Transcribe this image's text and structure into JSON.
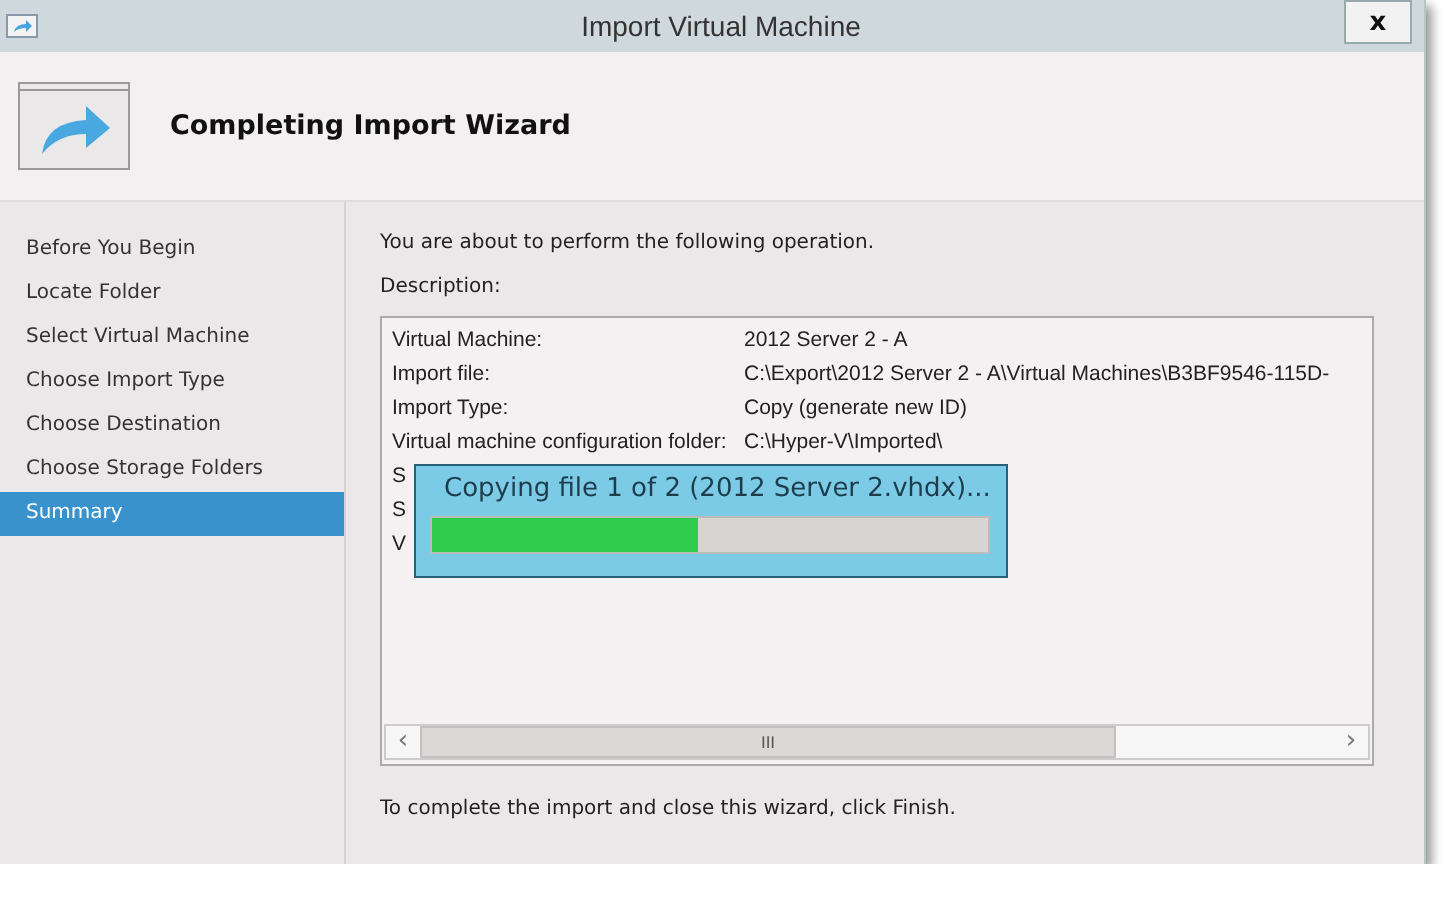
{
  "window": {
    "title": "Import Virtual Machine",
    "close": "x"
  },
  "header": {
    "title": "Completing Import Wizard"
  },
  "sidebar": {
    "items": [
      {
        "label": "Before You Begin",
        "selected": false
      },
      {
        "label": "Locate Folder",
        "selected": false
      },
      {
        "label": "Select Virtual Machine",
        "selected": false
      },
      {
        "label": "Choose Import Type",
        "selected": false
      },
      {
        "label": "Choose Destination",
        "selected": false
      },
      {
        "label": "Choose Storage Folders",
        "selected": false
      },
      {
        "label": "Summary",
        "selected": true
      }
    ]
  },
  "intro": "You are about to perform the following operation.",
  "description_label": "Description:",
  "description_rows": [
    {
      "label": "Virtual Machine:",
      "value": "2012 Server 2 - A"
    },
    {
      "label": "Import file:",
      "value": "C:\\Export\\2012 Server 2 - A\\Virtual Machines\\B3BF9546-115D-"
    },
    {
      "label": "Import Type:",
      "value": "Copy (generate new ID)"
    },
    {
      "label": "Virtual machine configuration folder:",
      "value": "C:\\Hyper-V\\Imported\\"
    },
    {
      "label": "S"
    },
    {
      "label": "S"
    },
    {
      "label": "V"
    }
  ],
  "scrollbar": {
    "left": "‹",
    "grip": "III",
    "right": "›"
  },
  "progress": {
    "text": "Copying file 1 of 2 (2012 Server 2.vhdx)...",
    "level": 0.48
  },
  "footer": "To complete the import and close this wizard, click Finish."
}
